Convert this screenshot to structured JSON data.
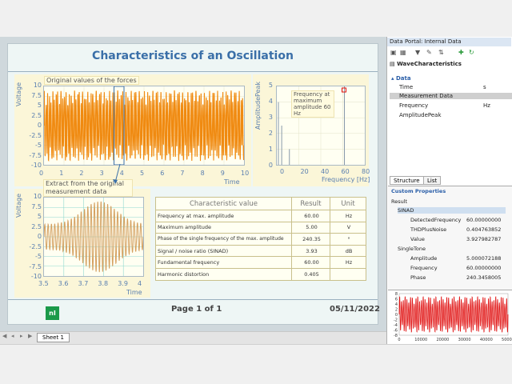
{
  "report": {
    "title": "Characteristics of an Oscillation",
    "footer_page": "Page 1 of 1",
    "footer_date": "05/11/2022",
    "logo_text": "nI"
  },
  "chart_data": [
    {
      "type": "line",
      "title": "",
      "callout": "Original values of the forces",
      "xlabel": "Time",
      "ylabel": "Voltage",
      "xlim": [
        0,
        10
      ],
      "ylim": [
        -10,
        10
      ],
      "xticks": [
        "0",
        "1",
        "2",
        "3",
        "4",
        "5",
        "6",
        "7",
        "8",
        "9",
        "10"
      ],
      "yticks": [
        "10",
        "7.5",
        "5",
        "2.5",
        "0",
        "-2.5",
        "-5",
        "-7.5",
        "-10"
      ],
      "series": [
        {
          "color": "#f08a10",
          "amplitude": 9,
          "frequency_hz": 60
        }
      ]
    },
    {
      "type": "bar",
      "title": "",
      "callout": "Frequency at maximum amplitude 60 Hz",
      "xlabel": "Frequency [Hz]",
      "ylabel": "AmplitudePeak",
      "xlim": [
        0,
        80
      ],
      "ylim": [
        0,
        5
      ],
      "xticks": [
        "0",
        "20",
        "40",
        "60",
        "80"
      ],
      "yticks": [
        "5",
        "4",
        "3",
        "2",
        "1",
        "0"
      ],
      "x": [
        0,
        3,
        10,
        60
      ],
      "values": [
        4.0,
        2.5,
        1.0,
        5.0
      ]
    },
    {
      "type": "line",
      "title": "",
      "callout": "Extract from the original measurement data",
      "xlabel": "Time",
      "ylabel": "Voltage",
      "xlim": [
        3.5,
        4
      ],
      "ylim": [
        -10,
        10
      ],
      "xticks": [
        "3.5",
        "3.6",
        "3.7",
        "3.8",
        "3.9",
        "4"
      ],
      "yticks": [
        "10",
        "7.5",
        "5",
        "2.5",
        "0",
        "-2.5",
        "-5",
        "-7.5",
        "-10"
      ],
      "series": [
        {
          "color": "#d4a060",
          "amplitude": 9,
          "frequency_hz": 60
        }
      ]
    }
  ],
  "table": {
    "headers": [
      "Characteristic value",
      "Result",
      "Unit"
    ],
    "rows": [
      [
        "Frequency at max. amplitude",
        "60.00",
        "Hz"
      ],
      [
        "Maximum amplitude",
        "5.00",
        "V"
      ],
      [
        "Phase of the single frequency of the max. amplitude",
        "240.35",
        "°"
      ],
      [
        "Signal / noise ratio (SINAD)",
        "3.93",
        "dB"
      ],
      [
        "Fundamental frequency",
        "60.00",
        "Hz"
      ],
      [
        "Harmonic distortion",
        "0.405",
        ""
      ]
    ]
  },
  "sheet": {
    "tab": "Sheet 1"
  },
  "portal": {
    "title": "Data Portal: Internal Data",
    "root": "WaveCharacteristics",
    "group": "Data",
    "channels": [
      {
        "name": "Time",
        "unit": "s"
      },
      {
        "name": "Measurement Data",
        "unit": ""
      },
      {
        "name": "Frequency",
        "unit": "Hz"
      },
      {
        "name": "AmplitudePeak",
        "unit": ""
      }
    ],
    "tabs": [
      "Structure",
      "List"
    ],
    "props_title": "Custom Properties",
    "props": {
      "result": "Result",
      "sinad": "SINAD",
      "sinad_items": [
        {
          "name": "DetectedFrequency",
          "value": "60.00000000"
        },
        {
          "name": "THDPlusNoise",
          "value": "0.404763852"
        },
        {
          "name": "Value",
          "value": "3.927982787"
        }
      ],
      "single": "SingleTone",
      "single_items": [
        {
          "name": "Amplitude",
          "value": "5.000072188"
        },
        {
          "name": "Frequency",
          "value": "60.00000000"
        },
        {
          "name": "Phase",
          "value": "240.3458005"
        }
      ]
    },
    "mini_chart": {
      "yticks": [
        "8",
        "6",
        "4",
        "2",
        "0",
        "-2",
        "-4",
        "-6",
        "-8"
      ],
      "xticks": [
        "0",
        "10000",
        "20000",
        "30000",
        "40000",
        "50000"
      ],
      "color": "#e01010"
    }
  },
  "colors": {
    "accent": "#3a6fa8",
    "orange": "#f08a10",
    "red": "#e01010",
    "ni_green": "#1b9a4a"
  }
}
